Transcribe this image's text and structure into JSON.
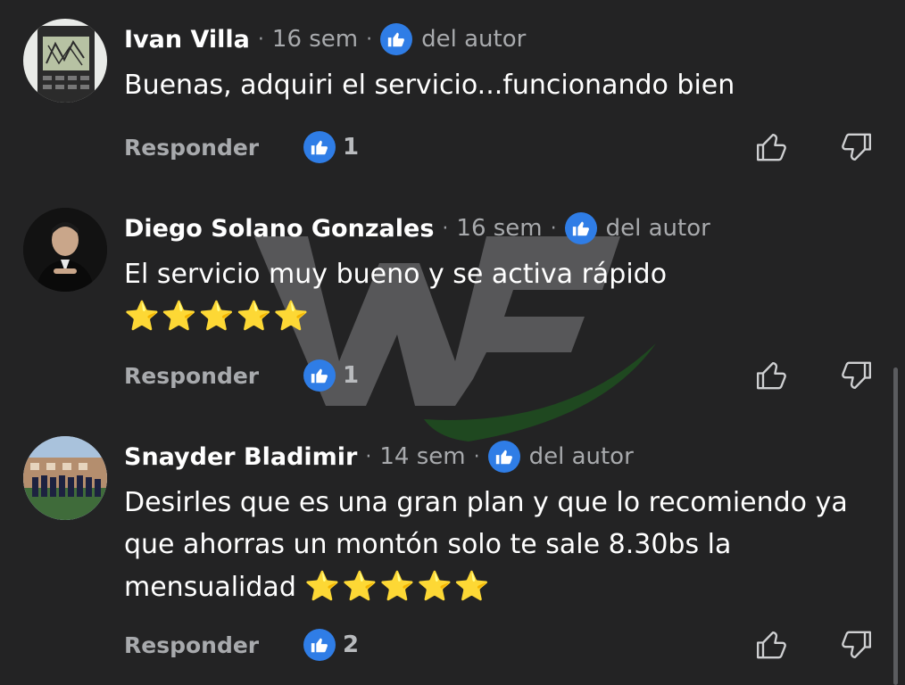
{
  "comments": [
    {
      "name": "Ivan Villa",
      "time": "16 sem",
      "author_tag": "del autor",
      "text": "Buenas, adquiri el servicio...funcionando bien",
      "stars": "",
      "reply_label": "Responder",
      "likes": "1"
    },
    {
      "name": "Diego Solano Gonzales",
      "time": "16 sem",
      "author_tag": "del autor",
      "text": "El servicio muy bueno y se activa rápido",
      "stars": "⭐⭐⭐⭐⭐",
      "reply_label": "Responder",
      "likes": "1"
    },
    {
      "name": "Snayder Bladimir",
      "time": "14 sem",
      "author_tag": "del autor",
      "text": "Desirles que es una gran plan y que lo recomiendo ya que ahorras un montón solo te sale 8.30bs la mensualidad",
      "stars": "⭐⭐⭐⭐⭐",
      "reply_label": "Responder",
      "likes": "2"
    }
  ],
  "separator": "·",
  "colors": {
    "background": "#232324",
    "accent": "#2f7de6",
    "muted_text": "#a8aaad",
    "star": "#ffd23a"
  },
  "icons": [
    "thumbs-up-badge-icon",
    "like-outline-icon",
    "dislike-outline-icon"
  ]
}
